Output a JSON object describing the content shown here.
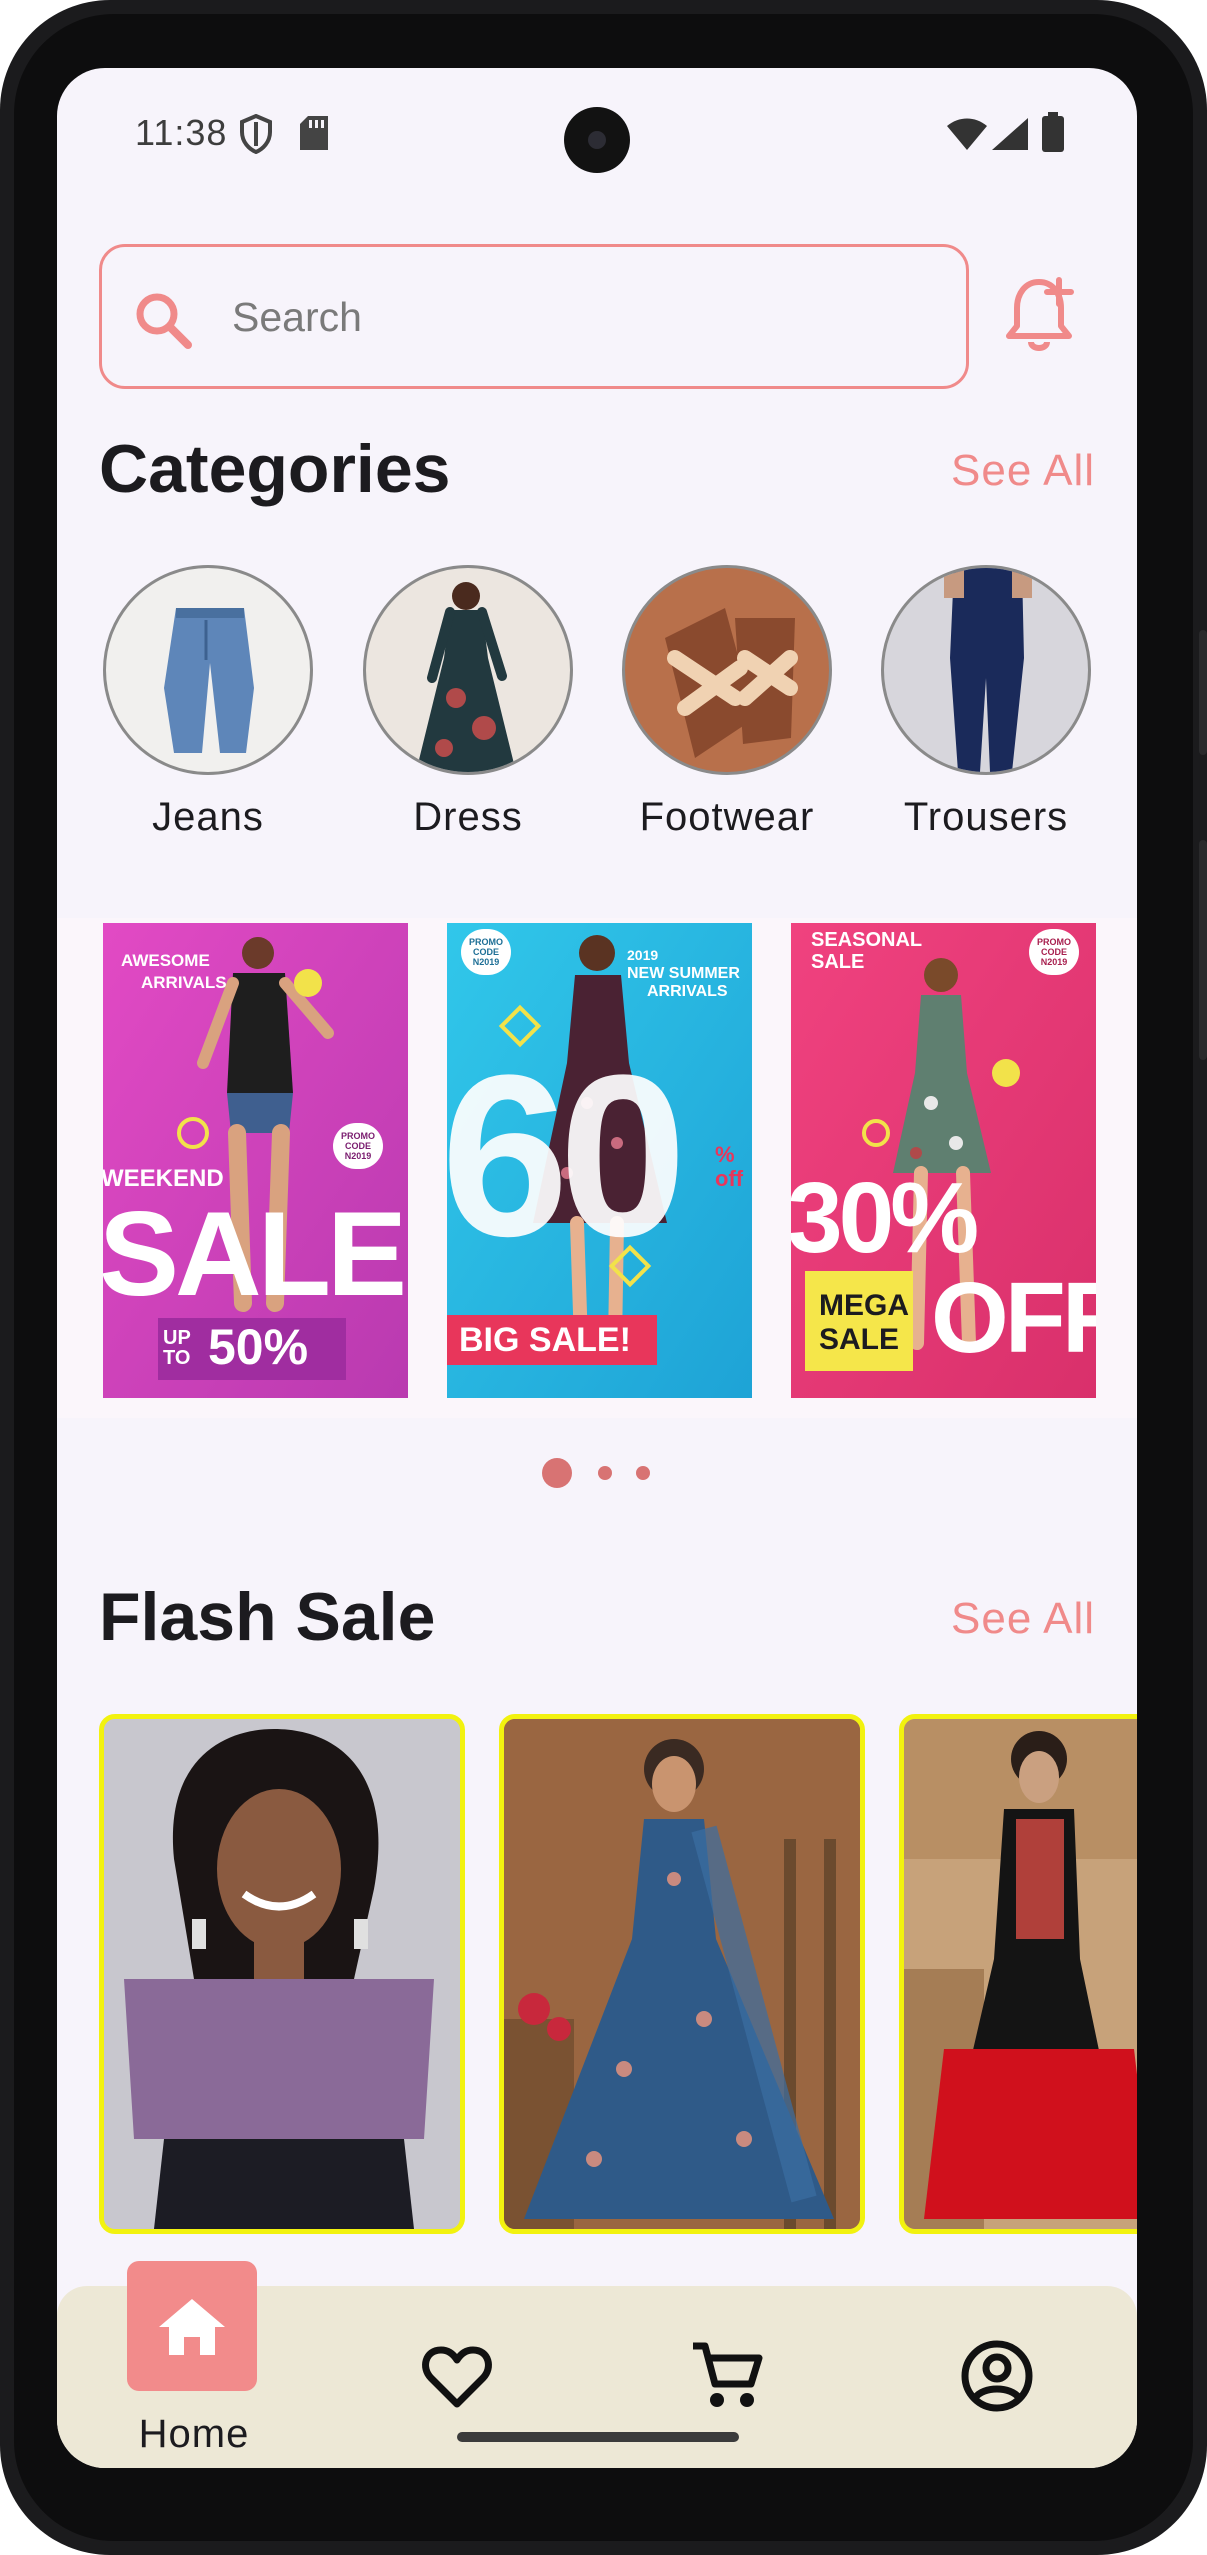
{
  "status_bar": {
    "time": "11:38"
  },
  "search": {
    "placeholder": "Search"
  },
  "categories": {
    "title": "Categories",
    "see_all": "See All",
    "items": [
      {
        "label": "Jeans"
      },
      {
        "label": "Dress"
      },
      {
        "label": "Footwear"
      },
      {
        "label": "Trousers"
      }
    ]
  },
  "banners": [
    {
      "lines": [
        "AWESOME",
        "ARRIVALS",
        "WEEKEND",
        "SALE",
        "UP TO",
        "50%",
        "PROMO CODE N2019"
      ],
      "color": "#d63fb9"
    },
    {
      "lines": [
        "2019",
        "NEW SUMMER",
        "ARRIVALS",
        "60",
        "% off",
        "BIG SALE!",
        "PROMO CODE N2019"
      ],
      "color": "#2bb6de"
    },
    {
      "lines": [
        "SEASONAL",
        "SALE",
        "30%",
        "OFF",
        "MEGA",
        "SALE",
        "PROMO CODE N2019"
      ],
      "color": "#e83a77"
    }
  ],
  "carousel": {
    "active_index": 0,
    "count": 3
  },
  "flash_sale": {
    "title": "Flash Sale",
    "see_all": "See All"
  },
  "bottom_nav": {
    "items": [
      {
        "label": "Home",
        "icon": "home-icon",
        "active": true
      },
      {
        "label": "",
        "icon": "heart-icon",
        "active": false
      },
      {
        "label": "",
        "icon": "cart-icon",
        "active": false
      },
      {
        "label": "",
        "icon": "account-icon",
        "active": false
      }
    ]
  },
  "colors": {
    "accent": "#f08a8a",
    "product_border": "#f2f20f",
    "nav_bg": "#ede8d6"
  }
}
